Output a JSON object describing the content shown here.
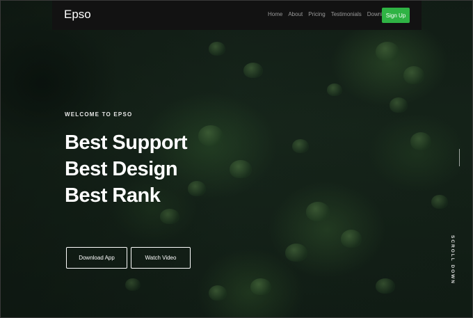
{
  "brand": {
    "name": "Epso"
  },
  "nav": {
    "items": [
      {
        "label": "Home"
      },
      {
        "label": "About"
      },
      {
        "label": "Pricing"
      },
      {
        "label": "Testimonials"
      },
      {
        "label": "Download"
      }
    ],
    "signup_label": "Sign Up"
  },
  "hero": {
    "eyebrow": "WELCOME TO EPSO",
    "headline_lines": [
      "Best Support",
      "Best Design",
      "Best Rank"
    ],
    "download_label": "Download App",
    "watch_label": "Watch Video",
    "scroll_label": "SCROLL DOWN"
  },
  "colors": {
    "accent": "#2fb344",
    "navbar_bg": "#121212",
    "text": "#ffffff"
  },
  "icons": []
}
